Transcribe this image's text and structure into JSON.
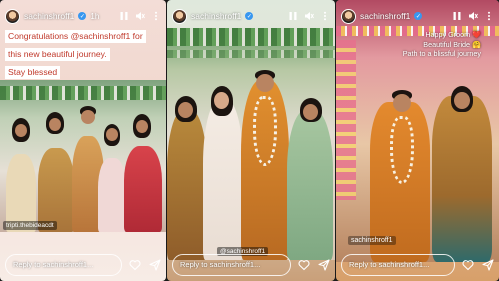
{
  "stories": [
    {
      "username": "sachinshroff1",
      "time": "1h",
      "caption_lines": [
        "Congratulations @sachinshroff1 for",
        "this new beautiful journey.",
        "Stay blessed"
      ],
      "photo_tag": "tripti.thebideacdt",
      "reply_text": "Reply to sachinshroff1..."
    },
    {
      "username": "sachinshroff1",
      "time": "",
      "photo_tag": "@sachinshroff1",
      "reply_text": "Reply to sachinshroff1..."
    },
    {
      "username": "sachinshroff1",
      "time": "",
      "overlay_lines": [
        "Happy Groom ❤️",
        "Beautiful Bride 🤗",
        "Path to a blissful journey"
      ],
      "photo_tag": "sachinshroff1",
      "reply_text": "Reply to sachinshroff1..."
    }
  ],
  "icons": {
    "verified": "verified-badge-icon",
    "pause": "pause-icon",
    "mute": "mute-icon",
    "more": "more-options-icon",
    "like": "heart-icon",
    "share": "send-icon"
  },
  "colors": {
    "caption_text": "#c0392b",
    "verified": "#3897f0"
  }
}
